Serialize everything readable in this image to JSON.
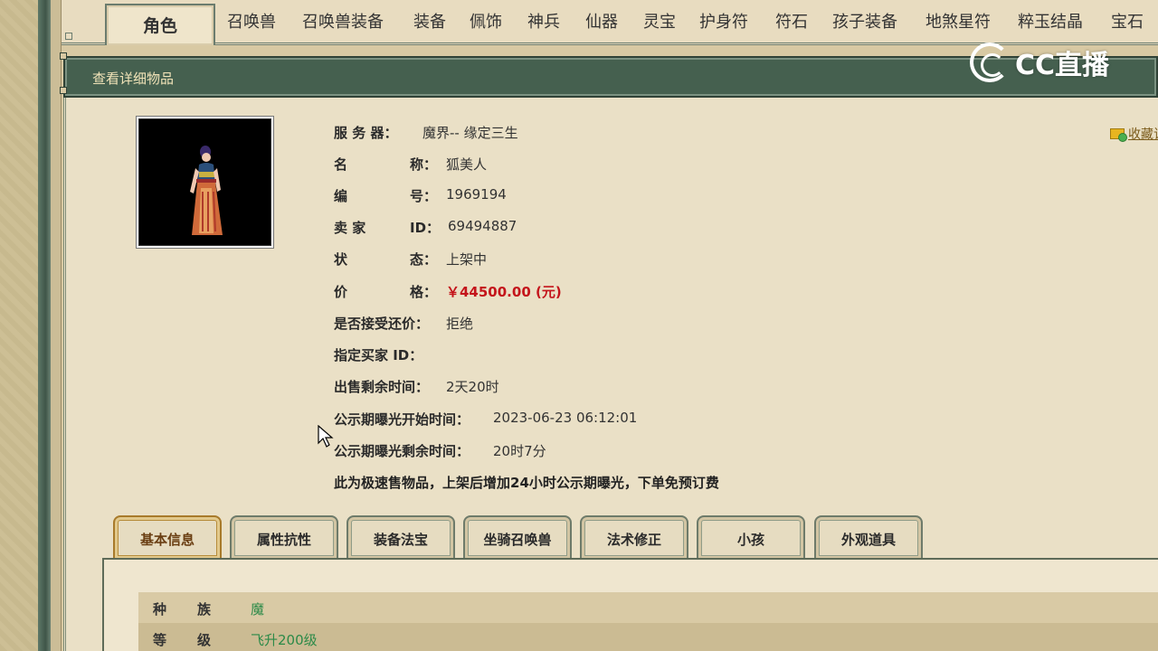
{
  "tabs": [
    "角色",
    "召唤兽",
    "召唤兽装备",
    "装备",
    "佩饰",
    "神兵",
    "仙器",
    "灵宝",
    "护身符",
    "符石",
    "孩子装备",
    "地煞星符",
    "粹玉结晶",
    "宝石"
  ],
  "active_tab": "角色",
  "header": {
    "title": "查看详细物品"
  },
  "logo_text": "CC直播",
  "favorite_label": "收藏该",
  "item": {
    "server_label": "服 务 器：",
    "server_value": "魔界-- 缘定三生",
    "name_label": "名",
    "name_label2": "称：",
    "name_value": "狐美人",
    "number_label": "编",
    "number_label2": "号：",
    "number_value": "1969194",
    "seller_label": "卖 家",
    "seller_label2": "ID：",
    "seller_value": "69494887",
    "status_label": "状",
    "status_label2": "态：",
    "status_value": "上架中",
    "price_label": "价",
    "price_label2": "格：",
    "price_value": "￥44500.00 (元)",
    "counter_offer_label": "是否接受还价：",
    "counter_offer_value": "拒绝",
    "buyer_id_label": "指定买家 ID：",
    "remaining_label": "出售剩余时间：",
    "remaining_value": "2天20时",
    "public_start_label": "公示期曝光开始时间：",
    "public_start_value": "2023-06-23 06:12:01",
    "public_remaining_label": "公示期曝光剩余时间：",
    "public_remaining_value": "20时7分",
    "notice": "此为极速售物品，上架后增加24小时公示期曝光，下单免预订费"
  },
  "sub_tabs": [
    "基本信息",
    "属性抗性",
    "装备法宝",
    "坐骑召唤兽",
    "法术修正",
    "小孩",
    "外观道具"
  ],
  "active_sub_tab": "基本信息",
  "attributes": [
    {
      "key": "种族",
      "value": "魔"
    },
    {
      "key": "等级",
      "value": "飞升200级"
    }
  ]
}
